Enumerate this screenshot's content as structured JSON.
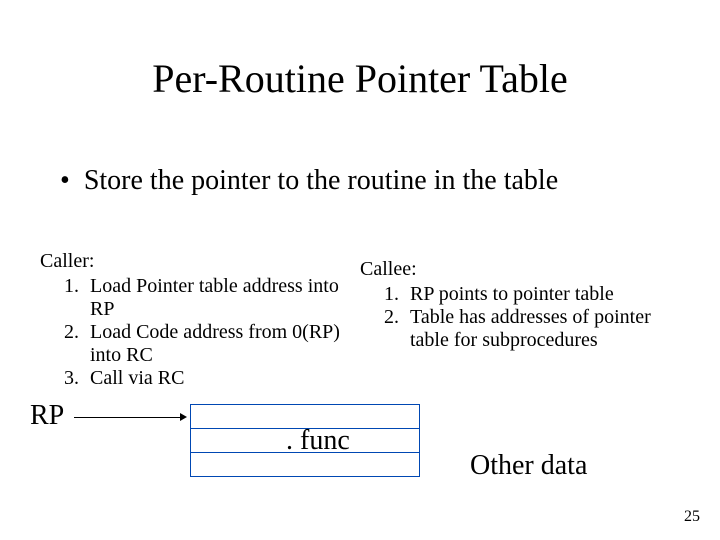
{
  "title": "Per-Routine Pointer Table",
  "bullet": "Store the pointer to the routine in the table",
  "caller": {
    "heading": "Caller:",
    "items": [
      "Load Pointer table address into RP",
      "Load Code address from 0(RP) into RC",
      "Call via RC"
    ]
  },
  "callee": {
    "heading": "Callee:",
    "items": [
      "RP points to pointer table",
      "Table has addresses of pointer table for subprocedures"
    ]
  },
  "diagram": {
    "rp_label": "RP",
    "func_label": ". func",
    "other_data": "Other data"
  },
  "page_number": "25"
}
